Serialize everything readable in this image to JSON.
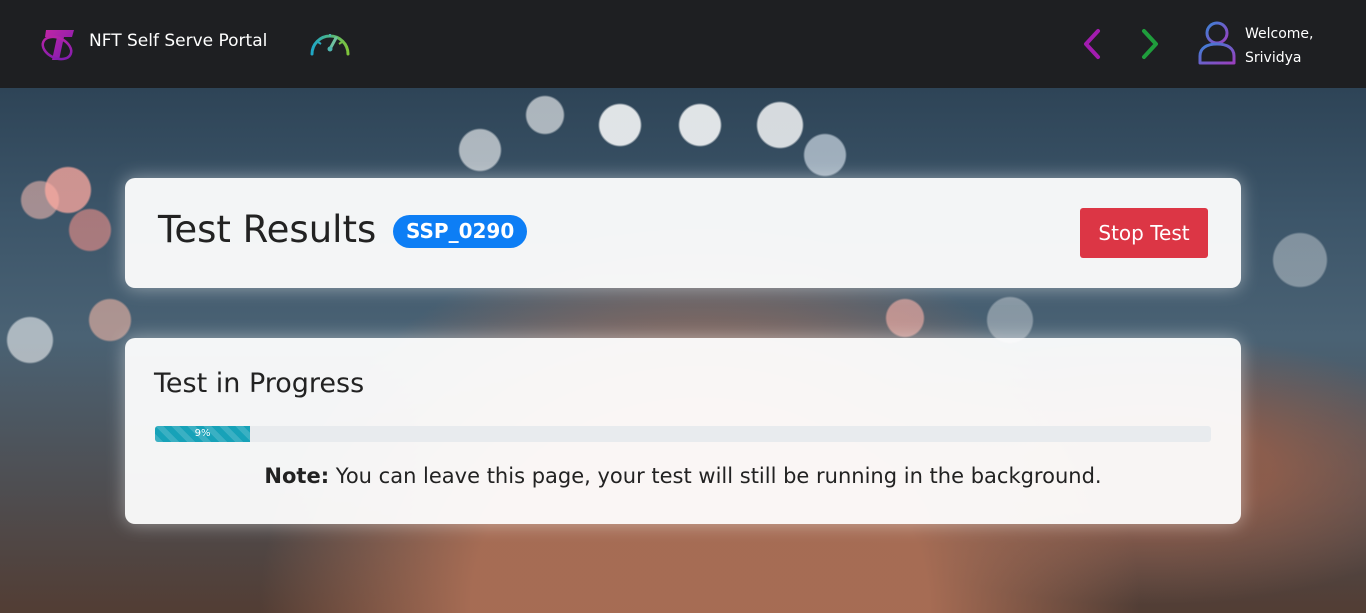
{
  "header": {
    "brand_name": "NFT Self Serve Portal",
    "welcome_line1": "Welcome,",
    "welcome_line2": "Srividya",
    "icons": {
      "logo": "telstra-logo-icon",
      "dashboard": "speedometer-icon",
      "back": "chevron-left-icon",
      "forward": "chevron-right-icon",
      "user": "user-icon"
    }
  },
  "results": {
    "title": "Test Results",
    "test_id": "SSP_0290",
    "stop_label": "Stop Test"
  },
  "progress": {
    "title": "Test in Progress",
    "percent": 9,
    "percent_label": "9%",
    "note_label": "Note:",
    "note_text": " You can leave this page, your test will still be running in the background."
  },
  "colors": {
    "brand_purple": "#9b1c96",
    "badge_blue": "#0d7ef5",
    "stop_red": "#dc3645",
    "progress_teal": "#17a2b8",
    "back_arrow": "#a21caf",
    "forward_arrow": "#1f9d3c"
  }
}
